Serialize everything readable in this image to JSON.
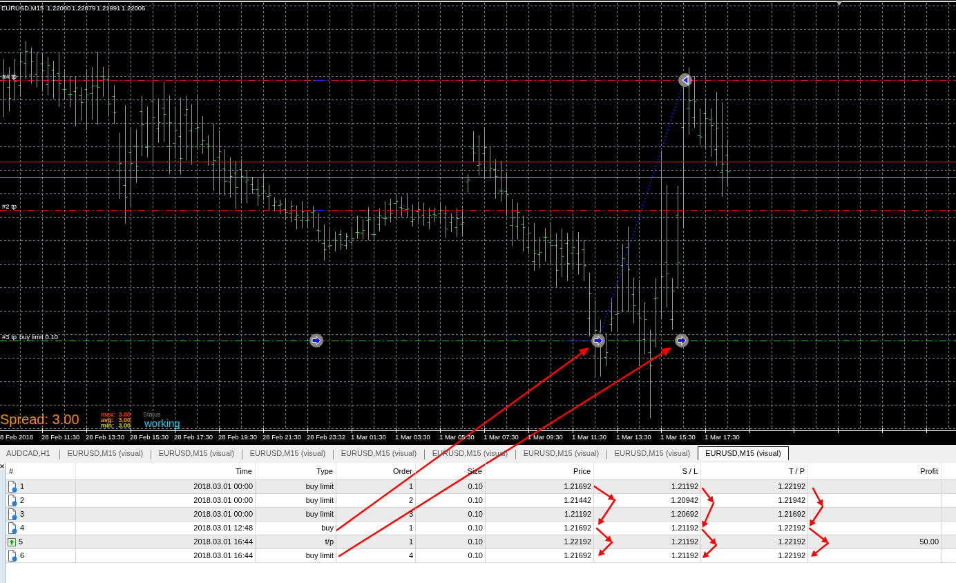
{
  "chart": {
    "symbol": "EURUSD,M15",
    "quotes": [
      "1.22000",
      "1.22079",
      "1.21991",
      "1.22006"
    ],
    "level_labels": [
      "#4 tp",
      "#2 tp",
      "#3 tp",
      "buy limit 0.10"
    ],
    "spread": "Spread: 3.00",
    "spread_stats": [
      {
        "label": "max:",
        "value": "3.00",
        "color": "#ff3300"
      },
      {
        "label": "avg:",
        "value": "3.00",
        "color": "#ff9900"
      },
      {
        "label": "min:",
        "value": "3.00",
        "color": "#d4d400"
      }
    ],
    "status": {
      "label": "Status",
      "value": "working"
    },
    "time_axis": [
      "8 Feb 2018",
      "28 Feb 11:30",
      "28 Feb 13:30",
      "28 Feb 15:30",
      "28 Feb 17:30",
      "28 Feb 19:30",
      "28 Feb 21:30",
      "28 Feb 23:32",
      "1 Mar 01:30",
      "1 Mar 03:30",
      "1 Mar 05:30",
      "1 Mar 07:30",
      "1 Mar 09:30",
      "1 Mar 11:30",
      "1 Mar 13:30",
      "1 Mar 15:30",
      "1 Mar 17:30"
    ]
  },
  "tabs": [
    {
      "label": "AUDCAD,H1",
      "selected": false
    },
    {
      "label": "EURUSD,M15 (visual)",
      "selected": false
    },
    {
      "label": "EURUSD,M15 (visual)",
      "selected": false
    },
    {
      "label": "EURUSD,M15 (visual)",
      "selected": false
    },
    {
      "label": "EURUSD,M15 (visual)",
      "selected": false
    },
    {
      "label": "EURUSD,M15 (visual)",
      "selected": false
    },
    {
      "label": "EURUSD,M15 (visual)",
      "selected": false
    },
    {
      "label": "EURUSD,M15 (visual)",
      "selected": false
    },
    {
      "label": "EURUSD,M15 (visual)",
      "selected": true
    }
  ],
  "table": {
    "columns": [
      "#",
      "Time",
      "Type",
      "Order",
      "Size",
      "Price",
      "S / L",
      "T / P",
      "Profit"
    ],
    "rows": [
      {
        "kind": "order",
        "number": "1",
        "time": "2018.03.01 00:00",
        "type": "buy limit",
        "order": "1",
        "size": "0.10",
        "price": "1.21692",
        "sl": "1.21192",
        "tp": "1.22192"
      },
      {
        "kind": "order",
        "number": "2",
        "time": "2018.03.01 00:00",
        "type": "buy limit",
        "order": "2",
        "size": "0.10",
        "price": "1.21442",
        "sl": "1.20942",
        "tp": "1.21942"
      },
      {
        "kind": "order",
        "number": "3",
        "time": "2018.03.01 00:00",
        "type": "buy limit",
        "order": "3",
        "size": "0.10",
        "price": "1.21192",
        "sl": "1.20692",
        "tp": "1.21692"
      },
      {
        "kind": "order",
        "number": "4",
        "time": "2018.03.01 12:48",
        "type": "buy",
        "order": "1",
        "size": "0.10",
        "price": "1.21692",
        "sl": "1.21192",
        "tp": "1.22192"
      },
      {
        "kind": "close",
        "number": "5",
        "time": "2018.03.01 16:44",
        "type": "t/p",
        "order": "1",
        "size": "0.10",
        "price": "1.22192",
        "sl": "1.21192",
        "tp": "1.22192",
        "profit": "50.00"
      },
      {
        "kind": "order",
        "number": "6",
        "time": "2018.03.01 16:44",
        "type": "buy limit",
        "order": "4",
        "size": "0.10",
        "price": "1.21692",
        "sl": "1.21192",
        "tp": "1.22192"
      }
    ]
  }
}
